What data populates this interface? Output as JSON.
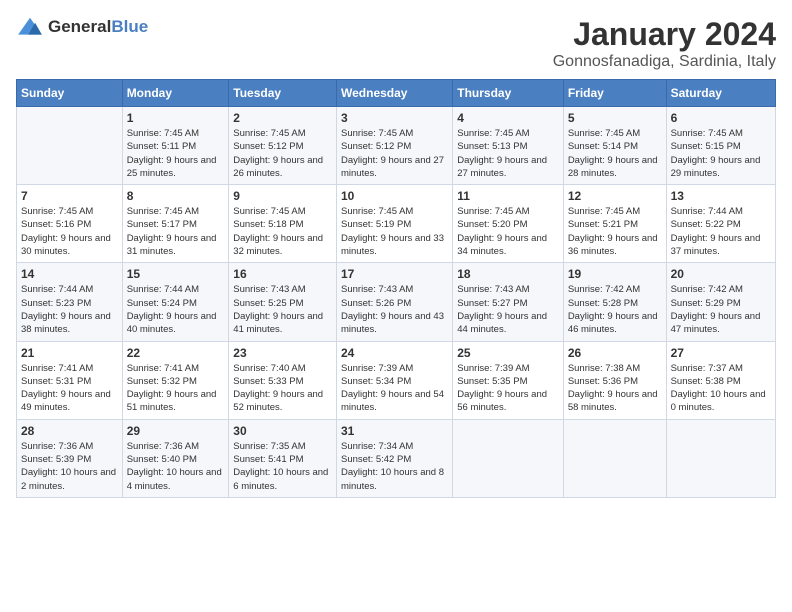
{
  "logo": {
    "general": "General",
    "blue": "Blue"
  },
  "title": "January 2024",
  "subtitle": "Gonnosfanadiga, Sardinia, Italy",
  "header_days": [
    "Sunday",
    "Monday",
    "Tuesday",
    "Wednesday",
    "Thursday",
    "Friday",
    "Saturday"
  ],
  "weeks": [
    [
      {
        "num": "",
        "sunrise": "",
        "sunset": "",
        "daylight": ""
      },
      {
        "num": "1",
        "sunrise": "Sunrise: 7:45 AM",
        "sunset": "Sunset: 5:11 PM",
        "daylight": "Daylight: 9 hours and 25 minutes."
      },
      {
        "num": "2",
        "sunrise": "Sunrise: 7:45 AM",
        "sunset": "Sunset: 5:12 PM",
        "daylight": "Daylight: 9 hours and 26 minutes."
      },
      {
        "num": "3",
        "sunrise": "Sunrise: 7:45 AM",
        "sunset": "Sunset: 5:12 PM",
        "daylight": "Daylight: 9 hours and 27 minutes."
      },
      {
        "num": "4",
        "sunrise": "Sunrise: 7:45 AM",
        "sunset": "Sunset: 5:13 PM",
        "daylight": "Daylight: 9 hours and 27 minutes."
      },
      {
        "num": "5",
        "sunrise": "Sunrise: 7:45 AM",
        "sunset": "Sunset: 5:14 PM",
        "daylight": "Daylight: 9 hours and 28 minutes."
      },
      {
        "num": "6",
        "sunrise": "Sunrise: 7:45 AM",
        "sunset": "Sunset: 5:15 PM",
        "daylight": "Daylight: 9 hours and 29 minutes."
      }
    ],
    [
      {
        "num": "7",
        "sunrise": "Sunrise: 7:45 AM",
        "sunset": "Sunset: 5:16 PM",
        "daylight": "Daylight: 9 hours and 30 minutes."
      },
      {
        "num": "8",
        "sunrise": "Sunrise: 7:45 AM",
        "sunset": "Sunset: 5:17 PM",
        "daylight": "Daylight: 9 hours and 31 minutes."
      },
      {
        "num": "9",
        "sunrise": "Sunrise: 7:45 AM",
        "sunset": "Sunset: 5:18 PM",
        "daylight": "Daylight: 9 hours and 32 minutes."
      },
      {
        "num": "10",
        "sunrise": "Sunrise: 7:45 AM",
        "sunset": "Sunset: 5:19 PM",
        "daylight": "Daylight: 9 hours and 33 minutes."
      },
      {
        "num": "11",
        "sunrise": "Sunrise: 7:45 AM",
        "sunset": "Sunset: 5:20 PM",
        "daylight": "Daylight: 9 hours and 34 minutes."
      },
      {
        "num": "12",
        "sunrise": "Sunrise: 7:45 AM",
        "sunset": "Sunset: 5:21 PM",
        "daylight": "Daylight: 9 hours and 36 minutes."
      },
      {
        "num": "13",
        "sunrise": "Sunrise: 7:44 AM",
        "sunset": "Sunset: 5:22 PM",
        "daylight": "Daylight: 9 hours and 37 minutes."
      }
    ],
    [
      {
        "num": "14",
        "sunrise": "Sunrise: 7:44 AM",
        "sunset": "Sunset: 5:23 PM",
        "daylight": "Daylight: 9 hours and 38 minutes."
      },
      {
        "num": "15",
        "sunrise": "Sunrise: 7:44 AM",
        "sunset": "Sunset: 5:24 PM",
        "daylight": "Daylight: 9 hours and 40 minutes."
      },
      {
        "num": "16",
        "sunrise": "Sunrise: 7:43 AM",
        "sunset": "Sunset: 5:25 PM",
        "daylight": "Daylight: 9 hours and 41 minutes."
      },
      {
        "num": "17",
        "sunrise": "Sunrise: 7:43 AM",
        "sunset": "Sunset: 5:26 PM",
        "daylight": "Daylight: 9 hours and 43 minutes."
      },
      {
        "num": "18",
        "sunrise": "Sunrise: 7:43 AM",
        "sunset": "Sunset: 5:27 PM",
        "daylight": "Daylight: 9 hours and 44 minutes."
      },
      {
        "num": "19",
        "sunrise": "Sunrise: 7:42 AM",
        "sunset": "Sunset: 5:28 PM",
        "daylight": "Daylight: 9 hours and 46 minutes."
      },
      {
        "num": "20",
        "sunrise": "Sunrise: 7:42 AM",
        "sunset": "Sunset: 5:29 PM",
        "daylight": "Daylight: 9 hours and 47 minutes."
      }
    ],
    [
      {
        "num": "21",
        "sunrise": "Sunrise: 7:41 AM",
        "sunset": "Sunset: 5:31 PM",
        "daylight": "Daylight: 9 hours and 49 minutes."
      },
      {
        "num": "22",
        "sunrise": "Sunrise: 7:41 AM",
        "sunset": "Sunset: 5:32 PM",
        "daylight": "Daylight: 9 hours and 51 minutes."
      },
      {
        "num": "23",
        "sunrise": "Sunrise: 7:40 AM",
        "sunset": "Sunset: 5:33 PM",
        "daylight": "Daylight: 9 hours and 52 minutes."
      },
      {
        "num": "24",
        "sunrise": "Sunrise: 7:39 AM",
        "sunset": "Sunset: 5:34 PM",
        "daylight": "Daylight: 9 hours and 54 minutes."
      },
      {
        "num": "25",
        "sunrise": "Sunrise: 7:39 AM",
        "sunset": "Sunset: 5:35 PM",
        "daylight": "Daylight: 9 hours and 56 minutes."
      },
      {
        "num": "26",
        "sunrise": "Sunrise: 7:38 AM",
        "sunset": "Sunset: 5:36 PM",
        "daylight": "Daylight: 9 hours and 58 minutes."
      },
      {
        "num": "27",
        "sunrise": "Sunrise: 7:37 AM",
        "sunset": "Sunset: 5:38 PM",
        "daylight": "Daylight: 10 hours and 0 minutes."
      }
    ],
    [
      {
        "num": "28",
        "sunrise": "Sunrise: 7:36 AM",
        "sunset": "Sunset: 5:39 PM",
        "daylight": "Daylight: 10 hours and 2 minutes."
      },
      {
        "num": "29",
        "sunrise": "Sunrise: 7:36 AM",
        "sunset": "Sunset: 5:40 PM",
        "daylight": "Daylight: 10 hours and 4 minutes."
      },
      {
        "num": "30",
        "sunrise": "Sunrise: 7:35 AM",
        "sunset": "Sunset: 5:41 PM",
        "daylight": "Daylight: 10 hours and 6 minutes."
      },
      {
        "num": "31",
        "sunrise": "Sunrise: 7:34 AM",
        "sunset": "Sunset: 5:42 PM",
        "daylight": "Daylight: 10 hours and 8 minutes."
      },
      {
        "num": "",
        "sunrise": "",
        "sunset": "",
        "daylight": ""
      },
      {
        "num": "",
        "sunrise": "",
        "sunset": "",
        "daylight": ""
      },
      {
        "num": "",
        "sunrise": "",
        "sunset": "",
        "daylight": ""
      }
    ]
  ]
}
